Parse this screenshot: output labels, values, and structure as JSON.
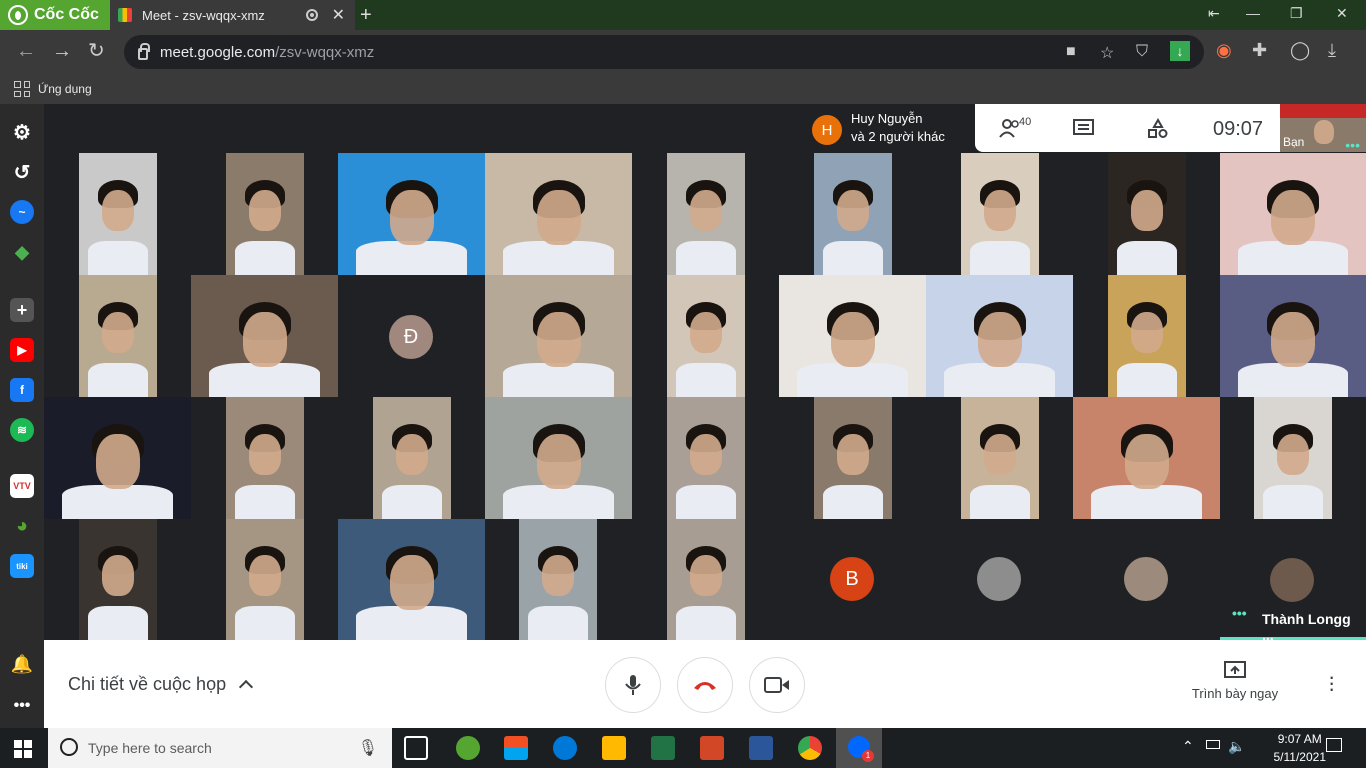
{
  "browser": {
    "brand": "Cốc Cốc",
    "tab_title": "Meet - zsv-wqqx-xmz",
    "url_host": "meet.google.com",
    "url_path": "/zsv-wqqx-xmz",
    "bookmark_apps": "Ứng dụng"
  },
  "meet": {
    "top_participant": "Huy Nguyễn",
    "top_participant_initial": "H",
    "top_participant_sub": "và 2 người khác",
    "participant_count": "40",
    "time": "09:07",
    "self_label": "Bạn",
    "avatars": [
      {
        "initial": "Đ",
        "color": "#a1887f"
      },
      {
        "initial": "B",
        "color": "#d84315"
      }
    ],
    "presenter_name": "Thành Longg ...",
    "details_label": "Chi tiết về cuộc họp",
    "present_label": "Trình bày ngay"
  },
  "taskbar": {
    "search_placeholder": "Type here to search",
    "time": "9:07 AM",
    "date": "5/11/2021"
  },
  "colors": {
    "accent": "#1a73e8",
    "end_call": "#d93025",
    "presenter_underline": "#5de2c4"
  }
}
